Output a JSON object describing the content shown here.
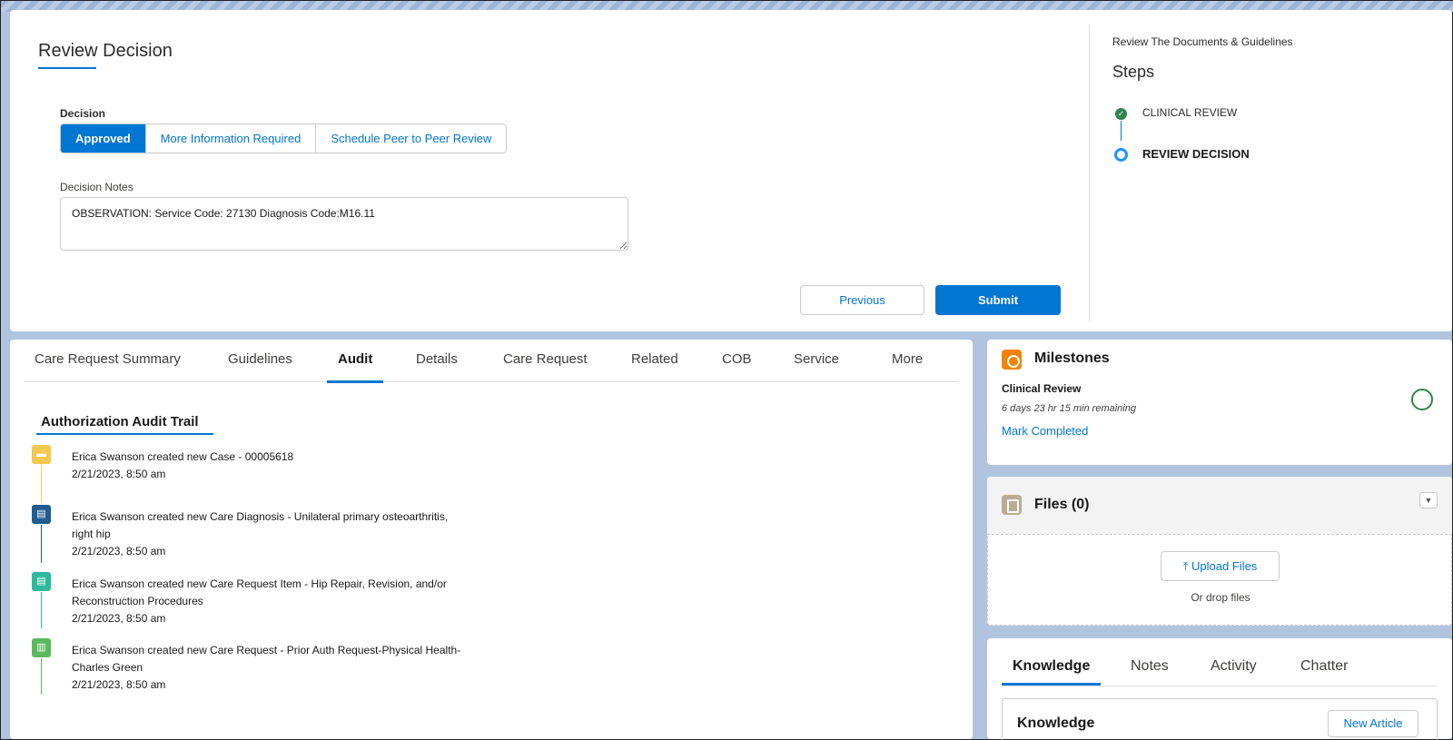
{
  "review": {
    "title": "Review Decision",
    "decision_label": "Decision",
    "decision_options": [
      "Approved",
      "More Information Required",
      "Schedule Peer to Peer Review"
    ],
    "selected_option": "Approved",
    "notes_label": "Decision Notes",
    "notes_value": "OBSERVATION: Service Code: 27130 Diagnosis Code:M16.11",
    "previous_label": "Previous",
    "submit_label": "Submit"
  },
  "steps": {
    "subtitle": "Review The Documents & Guidelines",
    "title": "Steps",
    "items": [
      {
        "label": "CLINICAL REVIEW",
        "status": "complete"
      },
      {
        "label": "REVIEW DECISION",
        "status": "current"
      }
    ]
  },
  "audit": {
    "tabs": [
      "Care Request Summary",
      "Guidelines",
      "Audit",
      "Details",
      "Care Request",
      "Related",
      "COB",
      "Service",
      "More"
    ],
    "active_tab": "Audit",
    "heading": "Authorization Audit Trail",
    "entries": [
      {
        "line1": "Erica Swanson created new Case - 00005618",
        "line2": "",
        "date": "2/21/2023, 8:50 am",
        "icon": "case-icon",
        "color": "#f4c94d"
      },
      {
        "line1": "Erica Swanson created new Care Diagnosis - Unilateral primary osteoarthritis,",
        "line2": "right hip",
        "date": "2/21/2023, 8:50 am",
        "icon": "diagnosis-icon",
        "color": "#1f5c8f"
      },
      {
        "line1": "Erica Swanson created new Care Request Item - Hip Repair, Revision, and/or",
        "line2": "Reconstruction Procedures",
        "date": "2/21/2023, 8:50 am",
        "icon": "request-item-icon",
        "color": "#2db99e"
      },
      {
        "line1": "Erica Swanson created new Care Request - Prior Auth Request-Physical Health-",
        "line2": "Charles Green",
        "date": "2/21/2023, 8:50 am",
        "icon": "care-request-icon",
        "color": "#5cb85c"
      }
    ]
  },
  "milestones": {
    "title": "Milestones",
    "name": "Clinical Review",
    "remaining": "6 days 23 hr 15 min remaining",
    "action": "Mark Completed"
  },
  "files": {
    "title": "Files (0)",
    "upload_label": "Upload Files",
    "drop_text": "Or drop files"
  },
  "knowledge": {
    "tabs": [
      "Knowledge",
      "Notes",
      "Activity",
      "Chatter"
    ],
    "active_tab": "Knowledge",
    "box_title": "Knowledge",
    "new_article_label": "New Article"
  },
  "colors": {
    "brand": "#0176d3",
    "success": "#2e844a",
    "milestone_icon": "#f38303",
    "files_icon": "#baac93"
  }
}
